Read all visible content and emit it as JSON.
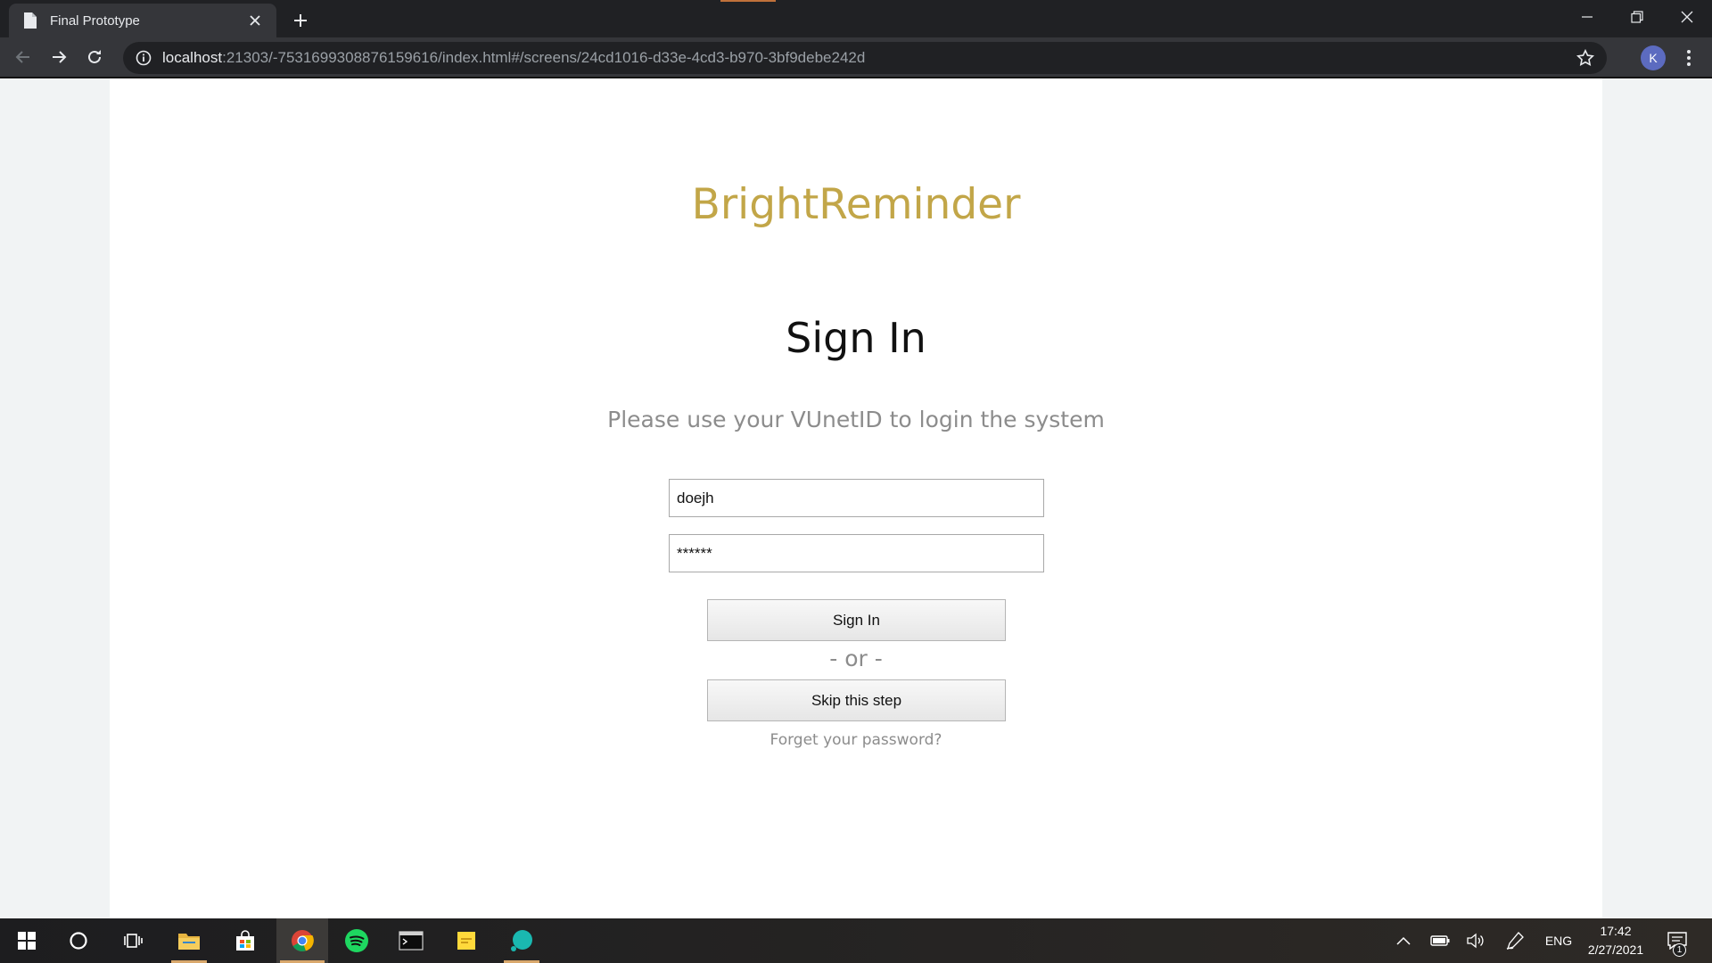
{
  "browser": {
    "tab_title": "Final Prototype",
    "url_host": "localhost",
    "url_rest": ":21303/-7531699308876159616/index.html#/screens/24cd1016-d33e-4cd3-b970-3bf9debe242d",
    "avatar_letter": "K"
  },
  "login": {
    "brand": "BrightReminder",
    "heading": "Sign In",
    "subtitle": "Please use your VUnetID to login the system",
    "username_value": "doejh",
    "password_value": "******",
    "signin_label": "Sign In",
    "or_label": "-  or  -",
    "skip_label": "Skip this step",
    "forgot_label": "Forget your password?"
  },
  "taskbar": {
    "language": "ENG",
    "time": "17:42",
    "date": "2/27/2021",
    "notification_count": "1"
  },
  "colors": {
    "brand": "#c2a648",
    "browser_dark": "#202124",
    "browser_toolbar": "#35363a",
    "muted_text": "#8c8c8c"
  },
  "icons": [
    "page-icon",
    "close-icon",
    "plus-icon",
    "minimize-icon",
    "restore-icon",
    "back-icon",
    "forward-icon",
    "reload-icon",
    "info-icon",
    "star-icon",
    "menu-dots-icon",
    "windows-start-icon",
    "search-circle-icon",
    "task-view-icon",
    "file-explorer-icon",
    "store-icon",
    "chrome-icon",
    "spotify-icon",
    "terminal-icon",
    "sticky-notes-icon",
    "app-icon",
    "chevron-up-icon",
    "battery-icon",
    "volume-icon",
    "pen-icon",
    "notification-icon"
  ]
}
